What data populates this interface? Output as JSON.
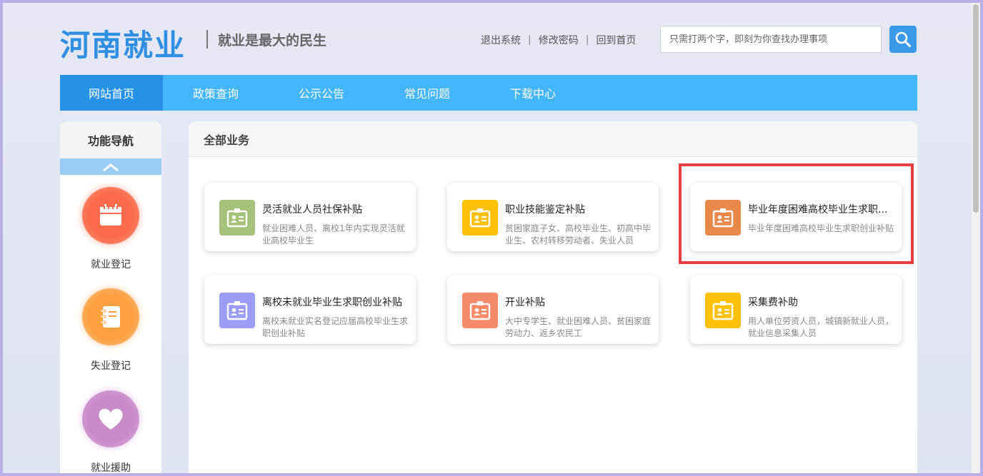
{
  "header": {
    "logo": "河南就业",
    "slogan": "就业是最大的民生",
    "links": [
      "退出系统",
      "修改密码",
      "回到首页"
    ],
    "separator": "|",
    "search_placeholder": "只需打两个字，即刻为你查找办理事项"
  },
  "nav": {
    "items": [
      "网站首页",
      "政策查询",
      "公示公告",
      "常见问题",
      "下载中心"
    ],
    "active_index": 0
  },
  "sidebar": {
    "title": "功能导航",
    "items": [
      {
        "label": "就业登记",
        "icon": "calendar-icon",
        "color": "#f96a4a"
      },
      {
        "label": "失业登记",
        "icon": "notebook-icon",
        "color": "#fca040"
      },
      {
        "label": "就业援助",
        "icon": "heart-icon",
        "color": "#c88ac9"
      }
    ]
  },
  "main": {
    "title": "全部业务",
    "cards": [
      {
        "title": "灵活就业人员社保补贴",
        "desc": "就业困难人员、离校1年内实现灵活就业高校毕业生",
        "color": "#a4c379",
        "icon": "id-card-icon"
      },
      {
        "title": "职业技能鉴定补贴",
        "desc": "贫困家庭子女、高校毕业生、初高中毕业生、农村转移劳动者、失业人员",
        "color": "#ffc107",
        "icon": "id-card-icon"
      },
      {
        "title": "毕业年度困难高校毕业生求职...",
        "desc": "毕业年度困难高校毕业生求职创业补贴",
        "color": "#e8894a",
        "icon": "id-card-icon"
      },
      {
        "title": "离校未就业毕业生求职创业补贴",
        "desc": "离校未就业实名登记应届高校毕业生求职创业补贴",
        "color": "#9d9cf4",
        "icon": "id-card-icon"
      },
      {
        "title": "开业补贴",
        "desc": "大中专学生、就业困难人员、贫困家庭劳动力、返乡农民工",
        "color": "#f68b6a",
        "icon": "id-card-icon"
      },
      {
        "title": "采集费补助",
        "desc": "用人单位劳资人员，城镇新就业人员，就业信息采集人员",
        "color": "#ffc107",
        "icon": "id-card-icon"
      }
    ]
  },
  "colors": {
    "primary": "#43b5fb",
    "nav_active": "#2592e6",
    "logo": "#2f8fe2",
    "highlight": "#ea3f3f"
  }
}
